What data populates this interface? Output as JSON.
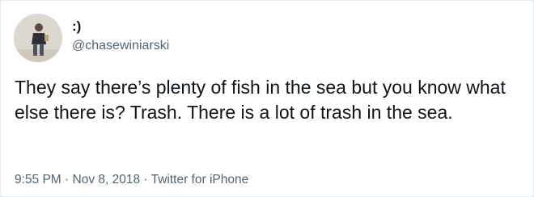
{
  "tweet": {
    "display_name": ":)",
    "handle": "@chasewiniarski",
    "text": "They say there’s plenty of fish in the sea but you know what else there is? Trash. There is a lot of trash in the sea.",
    "time": "9:55 PM",
    "separator": " · ",
    "date": "Nov 8, 2018",
    "source": "Twitter for iPhone"
  },
  "colors": {
    "text_primary": "#0f1419",
    "text_secondary": "#536471",
    "background": "#ffffff"
  }
}
